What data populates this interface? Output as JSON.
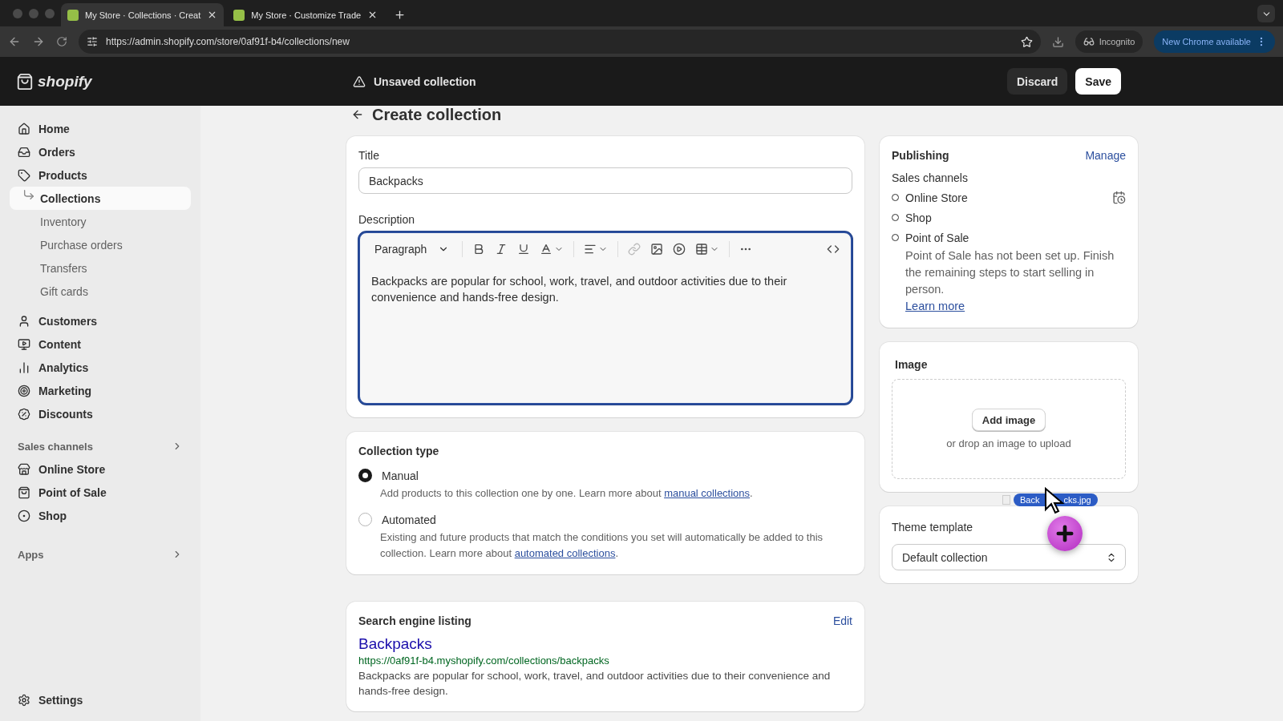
{
  "browser": {
    "tabs": [
      {
        "title": "My Store · Collections · Creat",
        "selected": true
      },
      {
        "title": "My Store · Customize Trade",
        "selected": false
      }
    ],
    "url": "https://admin.shopify.com/store/0af91f-b4/collections/new",
    "incognito": "Incognito",
    "update": "New Chrome available"
  },
  "topbar": {
    "logo": "shopify",
    "status": "Unsaved collection",
    "discard": "Discard",
    "save": "Save"
  },
  "sidebar": {
    "items": [
      {
        "label": "Home",
        "selected": false
      },
      {
        "label": "Orders",
        "selected": false
      },
      {
        "label": "Products",
        "selected": false,
        "children": [
          {
            "label": "Collections",
            "selected": true
          },
          {
            "label": "Inventory",
            "selected": false
          },
          {
            "label": "Purchase orders",
            "selected": false
          },
          {
            "label": "Transfers",
            "selected": false
          },
          {
            "label": "Gift cards",
            "selected": false
          }
        ]
      },
      {
        "label": "Customers",
        "selected": false
      },
      {
        "label": "Content",
        "selected": false
      },
      {
        "label": "Analytics",
        "selected": false
      },
      {
        "label": "Marketing",
        "selected": false
      },
      {
        "label": "Discounts",
        "selected": false
      }
    ],
    "sales_channels": {
      "heading": "Sales channels",
      "items": [
        {
          "label": "Online Store",
          "selected": false
        },
        {
          "label": "Point of Sale",
          "selected": false
        },
        {
          "label": "Shop",
          "selected": false
        }
      ]
    },
    "apps": {
      "heading": "Apps"
    },
    "settings": "Settings"
  },
  "page_title": "Create collection",
  "title_field": {
    "label": "Title",
    "value": "Backpacks"
  },
  "description": {
    "label": "Description",
    "block_style": "Paragraph",
    "text": "Backpacks are popular for school, work, travel, and outdoor activities due to their convenience and hands-free design."
  },
  "collection_type": {
    "heading": "Collection type",
    "options": [
      {
        "label": "Manual",
        "selected": true,
        "text": "Add products to this collection one by one. Learn more about ",
        "link": "manual collections",
        "after": "."
      },
      {
        "label": "Automated",
        "selected": false,
        "text": "Existing and future products that match the conditions you set will automatically be added to this collection. Learn more about ",
        "link": "automated collections",
        "after": "."
      }
    ]
  },
  "seo": {
    "heading": "Search engine listing",
    "action": "Edit",
    "title": "Backpacks",
    "url": "https://0af91f-b4.myshopify.com/collections/backpacks",
    "description": "Backpacks are popular for school, work, travel, and outdoor activities due to their convenience and hands-free design."
  },
  "publishing": {
    "heading": "Publishing",
    "action": "Manage",
    "subheading": "Sales channels",
    "channels": [
      {
        "name": "Online Store"
      },
      {
        "name": "Shop"
      },
      {
        "name": "Point of Sale",
        "note": "Point of Sale has not been set up. Finish the remaining steps to start selling in person.",
        "link": "Learn more"
      }
    ]
  },
  "image": {
    "heading": "Image",
    "button": "Add image",
    "hint": "or drop an image to upload"
  },
  "drag": {
    "label_start": "Back",
    "label_end": "cks.jpg"
  },
  "theme_template": {
    "label": "Theme template",
    "value": "Default collection"
  }
}
